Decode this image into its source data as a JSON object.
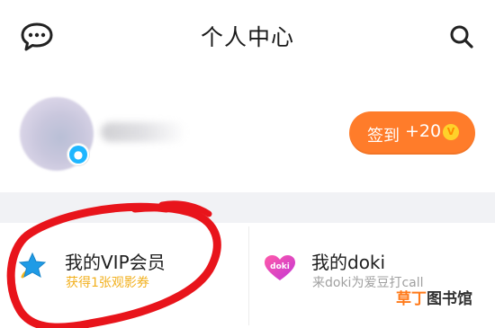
{
  "header": {
    "title": "个人中心",
    "left_icon": "message-icon",
    "right_icon": "search-icon"
  },
  "profile": {
    "badge_icon": "qq-penguin-icon",
    "checkin": {
      "label": "签到",
      "points": "+20",
      "coin_glyph": "V"
    },
    "checkin_color": "#ff7c2a"
  },
  "cards": [
    {
      "title": "我的VIP会员",
      "subtitle": "获得1张观影券",
      "icon": "vip-star-icon",
      "subtitle_color": "#f2b01e"
    },
    {
      "title": "我的doki",
      "subtitle": "来doki为爱豆打call",
      "icon": "doki-heart-icon",
      "icon_text": "doki"
    }
  ],
  "watermark": {
    "part1": "草丁",
    "part2": "图书馆"
  }
}
